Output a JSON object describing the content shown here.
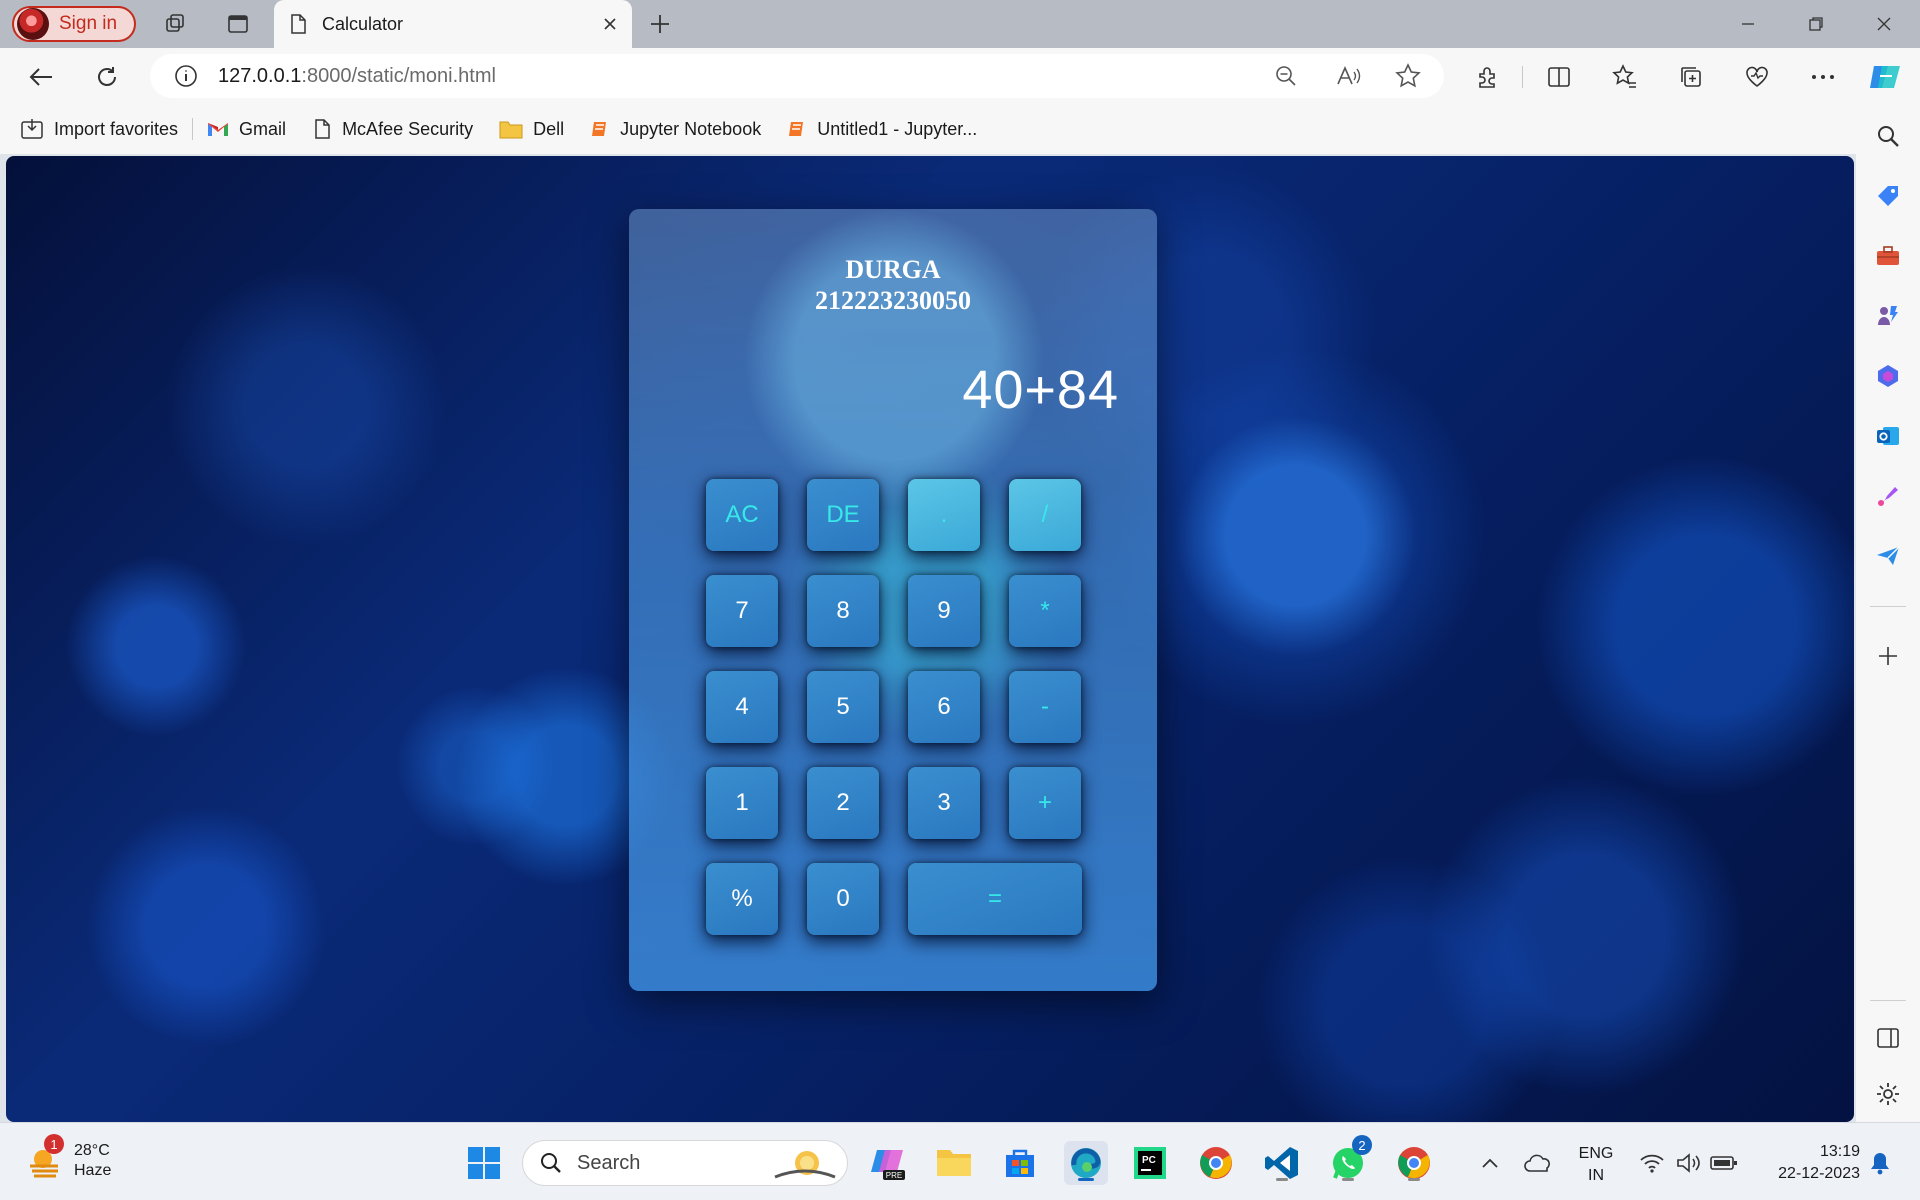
{
  "browser": {
    "signin_label": "Sign in",
    "tab_title": "Calculator",
    "url_host": "127.0.0.1",
    "url_path": ":8000/static/moni.html",
    "favorites": [
      {
        "label": "Import favorites",
        "icon": "import-icon"
      },
      {
        "label": "Gmail",
        "icon": "gmail-icon"
      },
      {
        "label": "McAfee Security",
        "icon": "page-icon"
      },
      {
        "label": "Dell",
        "icon": "folder-icon"
      },
      {
        "label": "Jupyter Notebook",
        "icon": "jupyter-icon"
      },
      {
        "label": "Untitled1 - Jupyter...",
        "icon": "jupyter-icon"
      }
    ]
  },
  "calculator": {
    "name": "DURGA",
    "id": "212223230050",
    "display": "40+84",
    "keys": {
      "ac": "AC",
      "de": "DE",
      "dot": ".",
      "div": "/",
      "k7": "7",
      "k8": "8",
      "k9": "9",
      "mul": "*",
      "k4": "4",
      "k5": "5",
      "k6": "6",
      "sub": "-",
      "k1": "1",
      "k2": "2",
      "k3": "3",
      "add": "+",
      "pct": "%",
      "k0": "0",
      "eq": "="
    }
  },
  "taskbar": {
    "weather_temp": "28°C",
    "weather_desc": "Haze",
    "weather_badge": "1",
    "search_placeholder": "Search",
    "whatsapp_badge": "2",
    "lang_line1": "ENG",
    "lang_line2": "IN",
    "time": "13:19",
    "date": "22-12-2023"
  },
  "colors": {
    "accent": "#c42b1c",
    "key_face": "#2a78c0",
    "operator_text": "#38e8e8"
  }
}
